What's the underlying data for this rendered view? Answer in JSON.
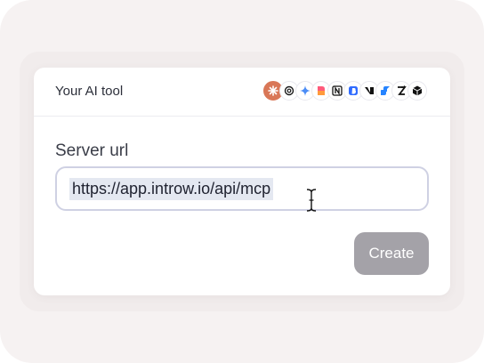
{
  "header": {
    "title": "Your AI tool"
  },
  "ai_tools": [
    {
      "name": "claude-icon",
      "color": "#d97757"
    },
    {
      "name": "openai-icon",
      "color": "#1a1a1a"
    },
    {
      "name": "gemini-icon",
      "color": "#4c8df6"
    },
    {
      "name": "lovable-icon",
      "color": "#ff5a7a"
    },
    {
      "name": "notion-icon",
      "color": "#111111"
    },
    {
      "name": "bolt-icon",
      "color": "#2f6bff"
    },
    {
      "name": "vercel-v0-icon",
      "color": "#111111"
    },
    {
      "name": "jira-icon",
      "color": "#2684ff"
    },
    {
      "name": "zapier-icon",
      "color": "#111111"
    },
    {
      "name": "cube-icon",
      "color": "#111111"
    }
  ],
  "form": {
    "label": "Server url",
    "url_value": "https://app.introw.io/api/mcp",
    "create_label": "Create"
  },
  "colors": {
    "accent_button_disabled": "#a4a2a8",
    "input_border": "#cfd1e3",
    "selection": "#e4e8f1"
  }
}
